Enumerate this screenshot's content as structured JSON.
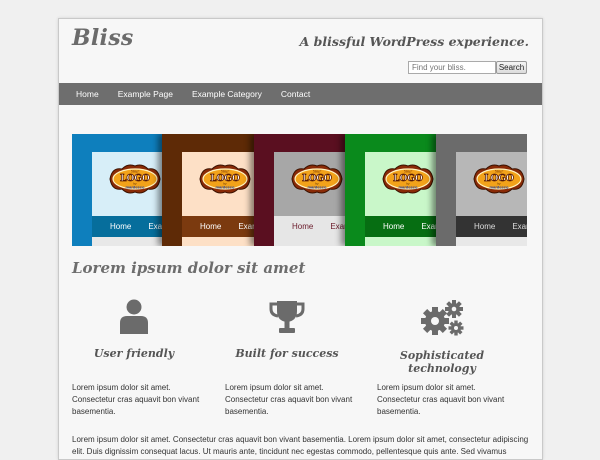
{
  "header": {
    "site_title": "Bliss",
    "tagline": "A blissful WordPress experience.",
    "search_placeholder": "Find your bliss.",
    "search_button": "Search"
  },
  "nav": {
    "items": [
      "Home",
      "Example Page",
      "Example Category",
      "Contact"
    ]
  },
  "slider": {
    "slides": [
      {
        "theme": "blue",
        "frame": "#0e7fbd",
        "panel": "#d7eef8",
        "bar": "#066e9c",
        "bar_text": "#ffffff",
        "bottom": "#e8e8e8",
        "item1": "Home",
        "item2": "Exam"
      },
      {
        "theme": "brown",
        "frame": "#5e2a06",
        "panel": "#fde0c6",
        "bar": "#7b3a0f",
        "bar_text": "#ffffff",
        "bottom": "#fde0c6",
        "item1": "Home",
        "item2": "Exam"
      },
      {
        "theme": "maroon",
        "frame": "#5a0f20",
        "panel": "#a7a7a7",
        "bar": "#e6e6e6",
        "bar_text": "#6a1a2a",
        "bottom": "#e6e6e6",
        "item1": "Home",
        "item2": "Exam"
      },
      {
        "theme": "green",
        "frame": "#0a8a1c",
        "panel": "#c9f7c9",
        "bar": "#066e12",
        "bar_text": "#ffffff",
        "bottom": "#c9f7c9",
        "item1": "Home",
        "item2": "Exam"
      },
      {
        "theme": "gray",
        "frame": "#6b6b6b",
        "panel": "#b7b7b7",
        "bar": "#333333",
        "bar_text": "#dddddd",
        "bottom": "#e8e8e8",
        "item1": "Home",
        "item2": "Exam"
      }
    ],
    "logo_text": "LOGO",
    "logo_sub": "mardesco",
    "logo_top": "Your",
    "logo_by": "by"
  },
  "main": {
    "heading": "Lorem ipsum dolor sit amet",
    "features": [
      {
        "icon": "user-icon",
        "title": "User friendly",
        "text": "Lorem ipsum dolor sit amet. Consectetur cras aquavit bon vivant basementia."
      },
      {
        "icon": "trophy-icon",
        "title": "Built for success",
        "text": "Lorem ipsum dolor sit amet. Consectetur cras aquavit bon vivant basementia."
      },
      {
        "icon": "gears-icon",
        "title": "Sophisticated technology",
        "text": "Lorem ipsum dolor sit amet. Consectetur cras aquavit bon vivant basementia."
      }
    ],
    "body_text": "Lorem ipsum dolor sit amet. Consectetur cras aquavit bon vivant basementia.  Lorem ipsum dolor sit amet, consectetur adipiscing elit. Duis dignissim consequat lacus. Ut mauris ante, tincidunt nec egestas commodo, pellentesque quis ante. Sed vivamus viverra mi, vel nasceteur vehicula."
  },
  "colors": {
    "nav_bg": "#6e6e6e",
    "icon": "#6b6b6b",
    "title": "#6b6b6b"
  }
}
